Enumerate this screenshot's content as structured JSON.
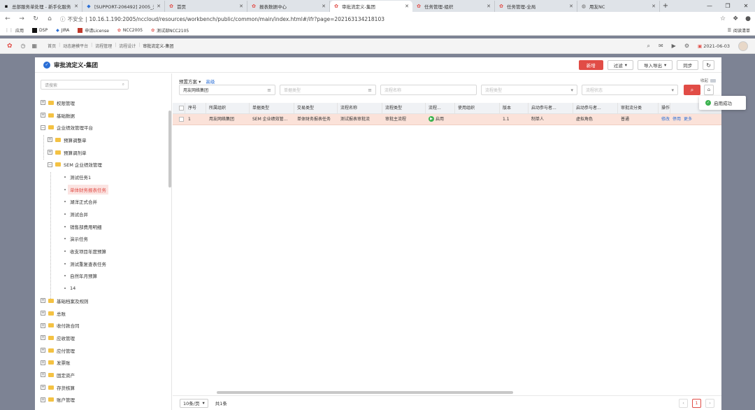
{
  "browser": {
    "tabs": [
      {
        "label": "总部服务单处理 - 新手化服务",
        "icon": "yonyou-logo"
      },
      {
        "label": "[SUPPORT-206492] 2005_开",
        "icon": "jira-diamond"
      },
      {
        "label": "首页",
        "icon": "ncc-logo"
      },
      {
        "label": "报表数据中心",
        "icon": "ncc-logo"
      },
      {
        "label": "审批流定义-集团",
        "icon": "ncc-logo",
        "active": true
      },
      {
        "label": "任务管理-组织",
        "icon": "ncc-logo"
      },
      {
        "label": "任务管理-全局",
        "icon": "ncc-logo"
      },
      {
        "label": "用友NC",
        "icon": "globe"
      }
    ],
    "new_tab": "+",
    "window_controls": [
      "—",
      "❐",
      "✕"
    ],
    "security": "不安全",
    "url": "10.16.1.190:2005/nccloud/resources/workbench/public/common/main/index.html#/ifr?page=202163134218103",
    "bookmarks": [
      "应用",
      "DSP",
      "JIRA",
      "申请License",
      "NCC2005",
      "测试部NCC2105"
    ],
    "reading_list": "阅读清单"
  },
  "app_header": {
    "breadcrumb": [
      "首页",
      "动态建模平台",
      "流程管理",
      "流程设计",
      "审批流定义-集团"
    ],
    "date": "2021-06-03"
  },
  "modal": {
    "title": "审批流定义-集团",
    "buttons": {
      "add": "新增",
      "filter": "过滤",
      "import_export": "导入导出",
      "sync": "同步"
    }
  },
  "tree": {
    "search_placeholder": "请搜索",
    "nodes": [
      {
        "label": "权限管理",
        "level": 0,
        "type": "folder",
        "exp": "+"
      },
      {
        "label": "基础数据",
        "level": 0,
        "type": "folder",
        "exp": "+"
      },
      {
        "label": "企业绩效管理平台",
        "level": 0,
        "type": "folder",
        "exp": "−"
      },
      {
        "label": "预算调整单",
        "level": 1,
        "type": "folder",
        "exp": "+"
      },
      {
        "label": "预算调剂单",
        "level": 1,
        "type": "folder",
        "exp": "+"
      },
      {
        "label": "SEM 企业绩效管理",
        "level": 1,
        "type": "folder",
        "exp": "−"
      },
      {
        "label": "测试任务1",
        "level": 2,
        "type": "leaf"
      },
      {
        "label": "单体财务报表任务",
        "level": 2,
        "type": "leaf",
        "selected": true
      },
      {
        "label": "湖洋正式合并",
        "level": 2,
        "type": "leaf"
      },
      {
        "label": "测试合并",
        "level": 2,
        "type": "leaf"
      },
      {
        "label": "销售部费用明细",
        "level": 2,
        "type": "leaf"
      },
      {
        "label": "演示任务",
        "level": 2,
        "type": "leaf"
      },
      {
        "label": "收支项目年度预算",
        "level": 2,
        "type": "leaf"
      },
      {
        "label": "测试重复查表任务",
        "level": 2,
        "type": "leaf"
      },
      {
        "label": "自然年月预算",
        "level": 2,
        "type": "leaf"
      },
      {
        "label": "14",
        "level": 2,
        "type": "leaf"
      },
      {
        "label": "基础档案及规则",
        "level": 0,
        "type": "folder",
        "exp": "+"
      },
      {
        "label": "总账",
        "level": 0,
        "type": "folder",
        "exp": "+"
      },
      {
        "label": "收付款合同",
        "level": 0,
        "type": "folder",
        "exp": "+"
      },
      {
        "label": "应收管理",
        "level": 0,
        "type": "folder",
        "exp": "+"
      },
      {
        "label": "应付管理",
        "level": 0,
        "type": "folder",
        "exp": "+"
      },
      {
        "label": "发票账",
        "level": 0,
        "type": "folder",
        "exp": "+"
      },
      {
        "label": "固定资产",
        "level": 0,
        "type": "folder",
        "exp": "+"
      },
      {
        "label": "存货核算",
        "level": 0,
        "type": "folder",
        "exp": "+"
      },
      {
        "label": "账户管理",
        "level": 0,
        "type": "folder",
        "exp": "+"
      }
    ]
  },
  "query": {
    "scheme_label": "预置方案",
    "advanced": "高级",
    "collapse": "收起",
    "fields": [
      {
        "value": "用友网络集团",
        "placeholder": ""
      },
      {
        "value": "",
        "placeholder": "单据类型"
      },
      {
        "value": "",
        "placeholder": "流程名称"
      },
      {
        "value": "",
        "placeholder": "流程类型"
      },
      {
        "value": "",
        "placeholder": "流程状态"
      }
    ]
  },
  "grid": {
    "columns": [
      "序号",
      "所属组织",
      "单据类型",
      "交易类型",
      "流程名称",
      "流程类型",
      "流程...",
      "使用组织",
      "版本",
      "启动参与者...",
      "启动参与者...",
      "审批流分类",
      "操作"
    ],
    "rows": [
      {
        "seq": "1",
        "org": "用友网络集团",
        "bill_type": "SEM 企业绩效管...",
        "trade_type": "单体财务报表任务",
        "name": "测试报表审批流",
        "flow_type": "审批主流程",
        "status": "启用",
        "use_org": "",
        "version": "1.1",
        "starter1": "制单人",
        "starter2": "虚拟角色",
        "category": "普通",
        "ops": [
          "修改",
          "停用",
          "更多"
        ]
      }
    ]
  },
  "pager": {
    "page_size": "10条/页",
    "total": "共1条",
    "prev": "‹",
    "current": "1",
    "next": "›"
  },
  "toast": {
    "message": "启用成功"
  },
  "colors": {
    "accent": "#e14c46",
    "link": "#2b6fd6",
    "success": "#3cb34f",
    "selected_row": "#fbe2d9"
  }
}
